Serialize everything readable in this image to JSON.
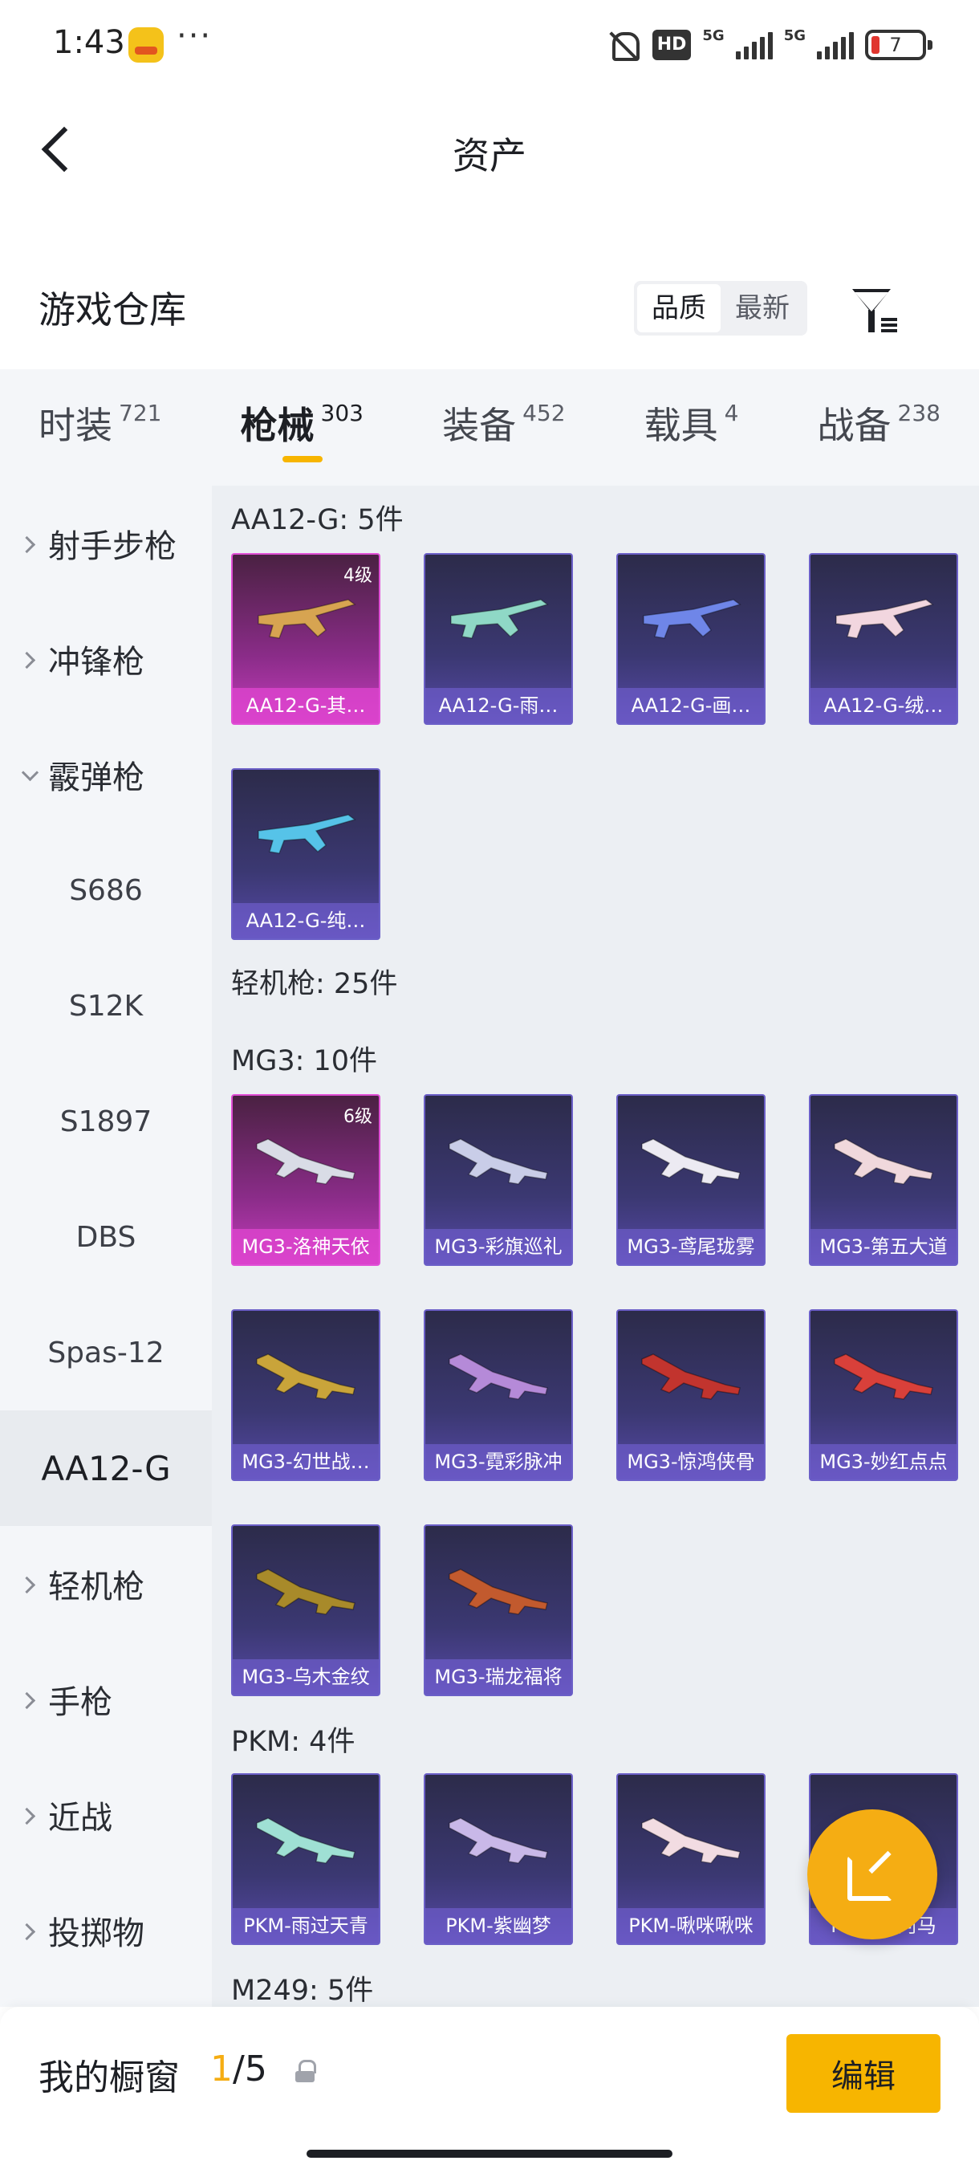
{
  "status_bar": {
    "time": "1:43",
    "dots": "···",
    "hd": "HD",
    "net1": "5G",
    "net2": "5G",
    "battery": "7"
  },
  "nav": {
    "title": "资产"
  },
  "warehouse": {
    "title": "游戏仓库",
    "sort_options": [
      "品质",
      "最新"
    ],
    "selected_sort": "品质"
  },
  "categories": [
    {
      "name": "时装",
      "count": "721"
    },
    {
      "name": "枪械",
      "count": "303",
      "active": true
    },
    {
      "name": "装备",
      "count": "452"
    },
    {
      "name": "载具",
      "count": "4"
    },
    {
      "name": "战备",
      "count": "238"
    }
  ],
  "sidebar": [
    {
      "label": "射手步枪",
      "type": "group",
      "chevron": "right"
    },
    {
      "label": "冲锋枪",
      "type": "group",
      "chevron": "right"
    },
    {
      "label": "霰弹枪",
      "type": "group",
      "chevron": "down"
    },
    {
      "label": "S686",
      "type": "sub"
    },
    {
      "label": "S12K",
      "type": "sub"
    },
    {
      "label": "S1897",
      "type": "sub"
    },
    {
      "label": "DBS",
      "type": "sub"
    },
    {
      "label": "Spas-12",
      "type": "sub"
    },
    {
      "label": "AA12-G",
      "type": "sub",
      "selected": true
    },
    {
      "label": "轻机枪",
      "type": "group",
      "chevron": "right"
    },
    {
      "label": "手枪",
      "type": "group",
      "chevron": "right"
    },
    {
      "label": "近战",
      "type": "group",
      "chevron": "right"
    },
    {
      "label": "投掷物",
      "type": "group",
      "chevron": "right"
    }
  ],
  "content": {
    "groups": [
      {
        "label": "AA12-G: 5件",
        "items": [
          {
            "name": "AA12-G-其…",
            "level": "4级",
            "rarity": "gold",
            "color": "#d7a451"
          },
          {
            "name": "AA12-G-雨…",
            "rarity": "purple",
            "color": "#8fd8c6"
          },
          {
            "name": "AA12-G-画…",
            "rarity": "purple",
            "color": "#6f86e8"
          },
          {
            "name": "AA12-G-绒…",
            "rarity": "purple",
            "color": "#f2d6df"
          },
          {
            "name": "AA12-G-纯…",
            "rarity": "purple",
            "color": "#56c3e8"
          }
        ]
      },
      {
        "label": "轻机枪: 25件",
        "items": []
      },
      {
        "label": "MG3: 10件",
        "items": [
          {
            "name": "MG3-洛神天依",
            "level": "6级",
            "rarity": "gold",
            "color": "#d9dce6"
          },
          {
            "name": "MG3-彩旗巡礼",
            "rarity": "purple",
            "color": "#c9cde8"
          },
          {
            "name": "MG3-鸢尾珑雾",
            "rarity": "purple",
            "color": "#eceaf2"
          },
          {
            "name": "MG3-第五大道",
            "rarity": "purple",
            "color": "#f0d8dc"
          },
          {
            "name": "MG3-幻世战…",
            "rarity": "purple",
            "color": "#c9a43a"
          },
          {
            "name": "MG3-霓彩脉冲",
            "rarity": "purple",
            "color": "#b58ad8"
          },
          {
            "name": "MG3-惊鸿侠骨",
            "rarity": "purple",
            "color": "#c2342e"
          },
          {
            "name": "MG3-妙红点点",
            "rarity": "purple",
            "color": "#d9403a"
          },
          {
            "name": "MG3-乌木金纹",
            "rarity": "purple",
            "color": "#a88a2a"
          },
          {
            "name": "MG3-瑞龙福将",
            "rarity": "purple",
            "color": "#c25a2e"
          }
        ]
      },
      {
        "label": "PKM: 4件",
        "items": [
          {
            "name": "PKM-雨过天青",
            "rarity": "purple",
            "color": "#9fe0d4"
          },
          {
            "name": "PKM-紫幽梦",
            "rarity": "purple",
            "color": "#c9b8e8"
          },
          {
            "name": "PKM-啾咪啾咪",
            "rarity": "purple",
            "color": "#f2dce2"
          },
          {
            "name": "PKM-…河马",
            "rarity": "purple",
            "color": "#8fb8c8"
          }
        ]
      },
      {
        "label": "M249: 5件",
        "items": []
      }
    ]
  },
  "bottom_bar": {
    "window_label": "我的橱窗",
    "window_current": "1",
    "window_total": "/5",
    "edit_label": "编辑"
  }
}
